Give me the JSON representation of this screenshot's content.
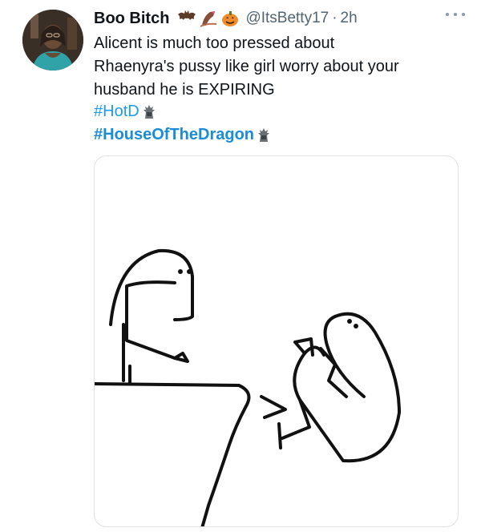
{
  "tweet": {
    "display_name": "Boo Bitch",
    "name_emojis": [
      "bat-emoji",
      "nail-polish-emoji",
      "pumpkin-emoji"
    ],
    "handle": "@ItsBetty17",
    "separator": "·",
    "time": "2h",
    "text_lines": [
      "Alicent is much too pressed about",
      "Rhaenyra's pussy like girl worry about your",
      "husband he is EXPIRING"
    ],
    "hashtags": [
      "#HotD",
      "#HouseOfTheDragon"
    ],
    "hashtag_icon": "iron-throne-icon",
    "media_description_icon": "stick-figure-kick-drawing",
    "colors": {
      "text": "#0f1419",
      "secondary": "#536471",
      "link": "#1d9bf0",
      "border": "#dfe3e6"
    }
  }
}
